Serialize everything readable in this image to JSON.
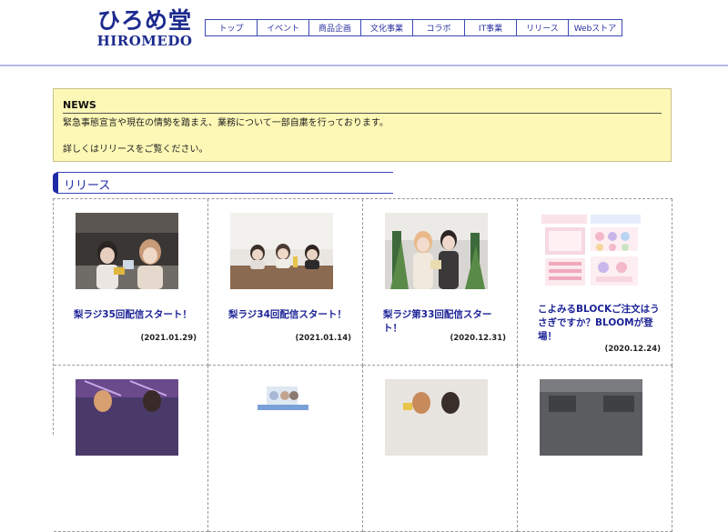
{
  "header": {
    "logo_kanji": "ひろめ堂",
    "logo_roman": "HIROMEDO",
    "nav": [
      "トップ",
      "イベント",
      "商品企画",
      "文化事業",
      "コラボ",
      "IT事業",
      "リリース",
      "Webストア"
    ]
  },
  "news": {
    "title": "NEWS",
    "line1": "緊急事態宣言や現在の情勢を踏まえ、業務について一部自粛を行っております。",
    "line2": "詳しくはリリースをご覧ください。"
  },
  "section": {
    "title": "リリース"
  },
  "cards": [
    {
      "title": "梨ラジ35回配信スタート！",
      "date": "(2021.01.29)"
    },
    {
      "title": "梨ラジ34回配信スタート！",
      "date": "(2021.01.14)"
    },
    {
      "title": "梨ラジ第33回配信スタート！",
      "date": "(2020.12.31)"
    },
    {
      "title": "こよみるBLOCKご注文はうさぎですか？BLOOMが登場！",
      "date": "(2020.12.24)"
    }
  ],
  "colors": {
    "brand": "#1d2b8f",
    "news_bg": "#fef8b6",
    "link": "#1d2496"
  }
}
